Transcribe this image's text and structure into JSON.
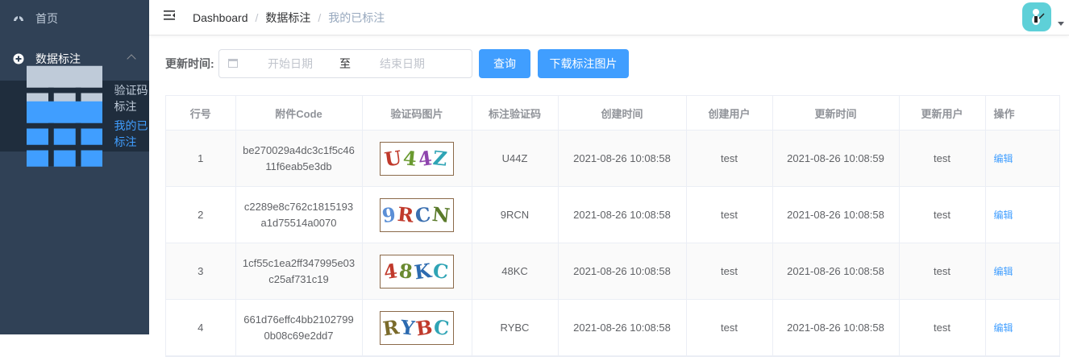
{
  "sidebar": {
    "items": [
      {
        "label": "首页",
        "icon": "dashboard-icon"
      },
      {
        "label": "数据标注",
        "icon": "plus-circle-icon",
        "expanded": true,
        "children": [
          {
            "label": "验证码标注",
            "icon": "table-icon"
          },
          {
            "label": "我的已标注",
            "icon": "table-icon",
            "active": true
          }
        ]
      }
    ]
  },
  "navbar": {
    "breadcrumb": [
      "Dashboard",
      "数据标注",
      "我的已标注"
    ]
  },
  "filter": {
    "label": "更新时间:",
    "start_placeholder": "开始日期",
    "range_separator": "至",
    "end_placeholder": "结束日期",
    "query_button": "查询",
    "download_button": "下载标注图片"
  },
  "table": {
    "columns": [
      "行号",
      "附件Code",
      "验证码图片",
      "标注验证码",
      "创建时间",
      "创建用户",
      "更新时间",
      "更新用户",
      "操作"
    ],
    "rows": [
      {
        "no": "1",
        "code": "be270029a4dc3c1f5c4611f6eab5e3db",
        "label": "U44Z",
        "created": "2021-08-26 10:08:58",
        "creator": "test",
        "updated": "2021-08-26 10:08:59",
        "updater": "test",
        "action": "编辑",
        "captcha_colors": [
          "#c0392b",
          "#6a9a30",
          "#8e44ad",
          "#2fa4b5"
        ]
      },
      {
        "no": "2",
        "code": "c2289e8c762c1815193a1d75514a0070",
        "label": "9RCN",
        "created": "2021-08-26 10:08:58",
        "creator": "test",
        "updated": "2021-08-26 10:08:58",
        "updater": "test",
        "action": "编辑",
        "captcha_colors": [
          "#5b8fd6",
          "#c0392b",
          "#3a6fb0",
          "#5a7a2a"
        ]
      },
      {
        "no": "3",
        "code": "1cf55c1ea2ff347995e03c25af731c19",
        "label": "48KC",
        "created": "2021-08-26 10:08:58",
        "creator": "test",
        "updated": "2021-08-26 10:08:58",
        "updater": "test",
        "action": "编辑",
        "captcha_colors": [
          "#c0392b",
          "#6a8a30",
          "#2c6ab0",
          "#2fa4b5"
        ]
      },
      {
        "no": "4",
        "code": "661d76effc4bb21027990b08c69e2dd7",
        "label": "RYBC",
        "created": "2021-08-26 10:08:58",
        "creator": "test",
        "updated": "2021-08-26 10:08:58",
        "updater": "test",
        "action": "编辑",
        "captcha_colors": [
          "#7a6a2a",
          "#2c6ab0",
          "#c0392b",
          "#2fa4b5"
        ]
      }
    ]
  }
}
